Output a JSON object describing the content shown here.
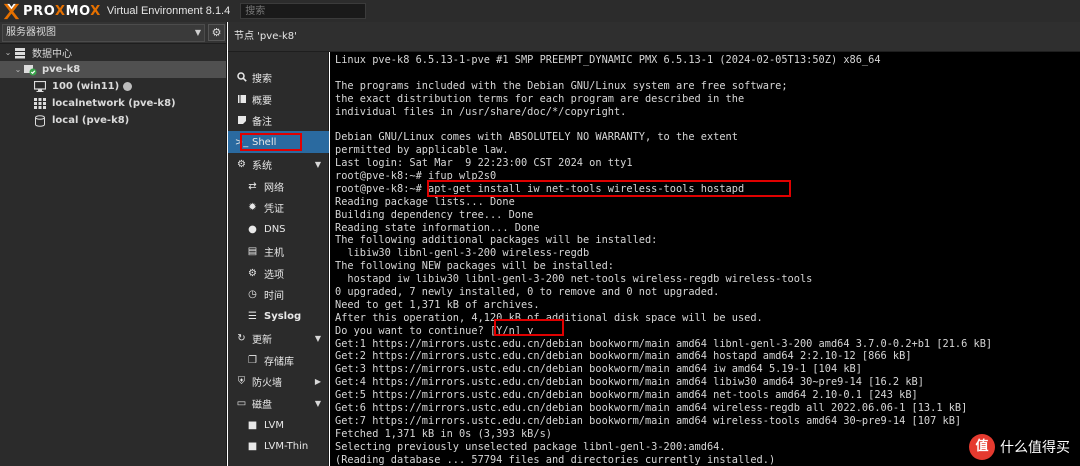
{
  "header": {
    "brand_prefix": "PRO",
    "brand_x": "X",
    "brand_mid": "MO",
    "brand_x2": "X",
    "version_label": "Virtual Environment 8.1.4",
    "search_placeholder": "搜索"
  },
  "tree": {
    "view_label": "服务器视图",
    "items": [
      {
        "label": "数据中心",
        "icon": "datacenter-icon"
      },
      {
        "label": "pve-k8",
        "icon": "node-online-icon"
      },
      {
        "label": "100 (win11)",
        "icon": "monitor-icon"
      },
      {
        "label": "localnetwork (pve-k8)",
        "icon": "grid-network-icon"
      },
      {
        "label": "local (pve-k8)",
        "icon": "storage-icon"
      }
    ]
  },
  "content": {
    "title": "节点 'pve-k8'"
  },
  "menu": {
    "items": [
      {
        "label": "搜索",
        "icon": "search-icon"
      },
      {
        "label": "概要",
        "icon": "book-icon"
      },
      {
        "label": "备注",
        "icon": "note-icon"
      },
      {
        "label": "Shell",
        "icon": "terminal-icon"
      },
      {
        "label": "系统",
        "icon": "cogs-icon"
      },
      {
        "label": "网络",
        "icon": "network-arrows-icon"
      },
      {
        "label": "凭证",
        "icon": "certificate-icon"
      },
      {
        "label": "DNS",
        "icon": "globe-icon"
      },
      {
        "label": "主机",
        "icon": "file-icon"
      },
      {
        "label": "选项",
        "icon": "gear-icon"
      },
      {
        "label": "时间",
        "icon": "clock-icon"
      },
      {
        "label": "Syslog",
        "icon": "list-icon"
      },
      {
        "label": "更新",
        "icon": "refresh-icon"
      },
      {
        "label": "存储库",
        "icon": "files-icon"
      },
      {
        "label": "防火墙",
        "icon": "shield-icon"
      },
      {
        "label": "磁盘",
        "icon": "hdd-icon"
      },
      {
        "label": "LVM",
        "icon": "square-icon"
      },
      {
        "label": "LVM-Thin",
        "icon": "square-icon"
      }
    ]
  },
  "terminal": {
    "lines": [
      "Linux pve-k8 6.5.13-1-pve #1 SMP PREEMPT_DYNAMIC PMX 6.5.13-1 (2024-02-05T13:50Z) x86_64",
      "",
      "The programs included with the Debian GNU/Linux system are free software;",
      "the exact distribution terms for each program are described in the",
      "individual files in /usr/share/doc/*/copyright.",
      "",
      "Debian GNU/Linux comes with ABSOLUTELY NO WARRANTY, to the extent",
      "permitted by applicable law.",
      "Last login: Sat Mar  9 22:23:00 CST 2024 on tty1",
      "root@pve-k8:~# ifup wlp2s0",
      "root@pve-k8:~# apt-get install iw net-tools wireless-tools hostapd",
      "Reading package lists... Done",
      "Building dependency tree... Done",
      "Reading state information... Done",
      "The following additional packages will be installed:",
      "  libiw30 libnl-genl-3-200 wireless-regdb",
      "The following NEW packages will be installed:",
      "  hostapd iw libiw30 libnl-genl-3-200 net-tools wireless-regdb wireless-tools",
      "0 upgraded, 7 newly installed, 0 to remove and 0 not upgraded.",
      "Need to get 1,371 kB of archives.",
      "After this operation, 4,120 kB of additional disk space will be used.",
      "Do you want to continue? [Y/n] y",
      "Get:1 https://mirrors.ustc.edu.cn/debian bookworm/main amd64 libnl-genl-3-200 amd64 3.7.0-0.2+b1 [21.6 kB]",
      "Get:2 https://mirrors.ustc.edu.cn/debian bookworm/main amd64 hostapd amd64 2:2.10-12 [866 kB]",
      "Get:3 https://mirrors.ustc.edu.cn/debian bookworm/main amd64 iw amd64 5.19-1 [104 kB]",
      "Get:4 https://mirrors.ustc.edu.cn/debian bookworm/main amd64 libiw30 amd64 30~pre9-14 [16.2 kB]",
      "Get:5 https://mirrors.ustc.edu.cn/debian bookworm/main amd64 net-tools amd64 2.10-0.1 [243 kB]",
      "Get:6 https://mirrors.ustc.edu.cn/debian bookworm/main amd64 wireless-regdb all 2022.06.06-1 [13.1 kB]",
      "Get:7 https://mirrors.ustc.edu.cn/debian bookworm/main amd64 wireless-tools amd64 30~pre9-14 [107 kB]",
      "Fetched 1,371 kB in 0s (3,393 kB/s)",
      "Selecting previously unselected package libnl-genl-3-200:amd64.",
      "(Reading database ... 57794 files and directories currently installed.)"
    ]
  },
  "watermark": {
    "badge": "值",
    "text": "什么值得买"
  },
  "colors": {
    "accent_orange": "#e57000",
    "selected_blue": "#2a6aa0",
    "annotation_red": "#e00000",
    "online_green": "#3aa34b"
  }
}
